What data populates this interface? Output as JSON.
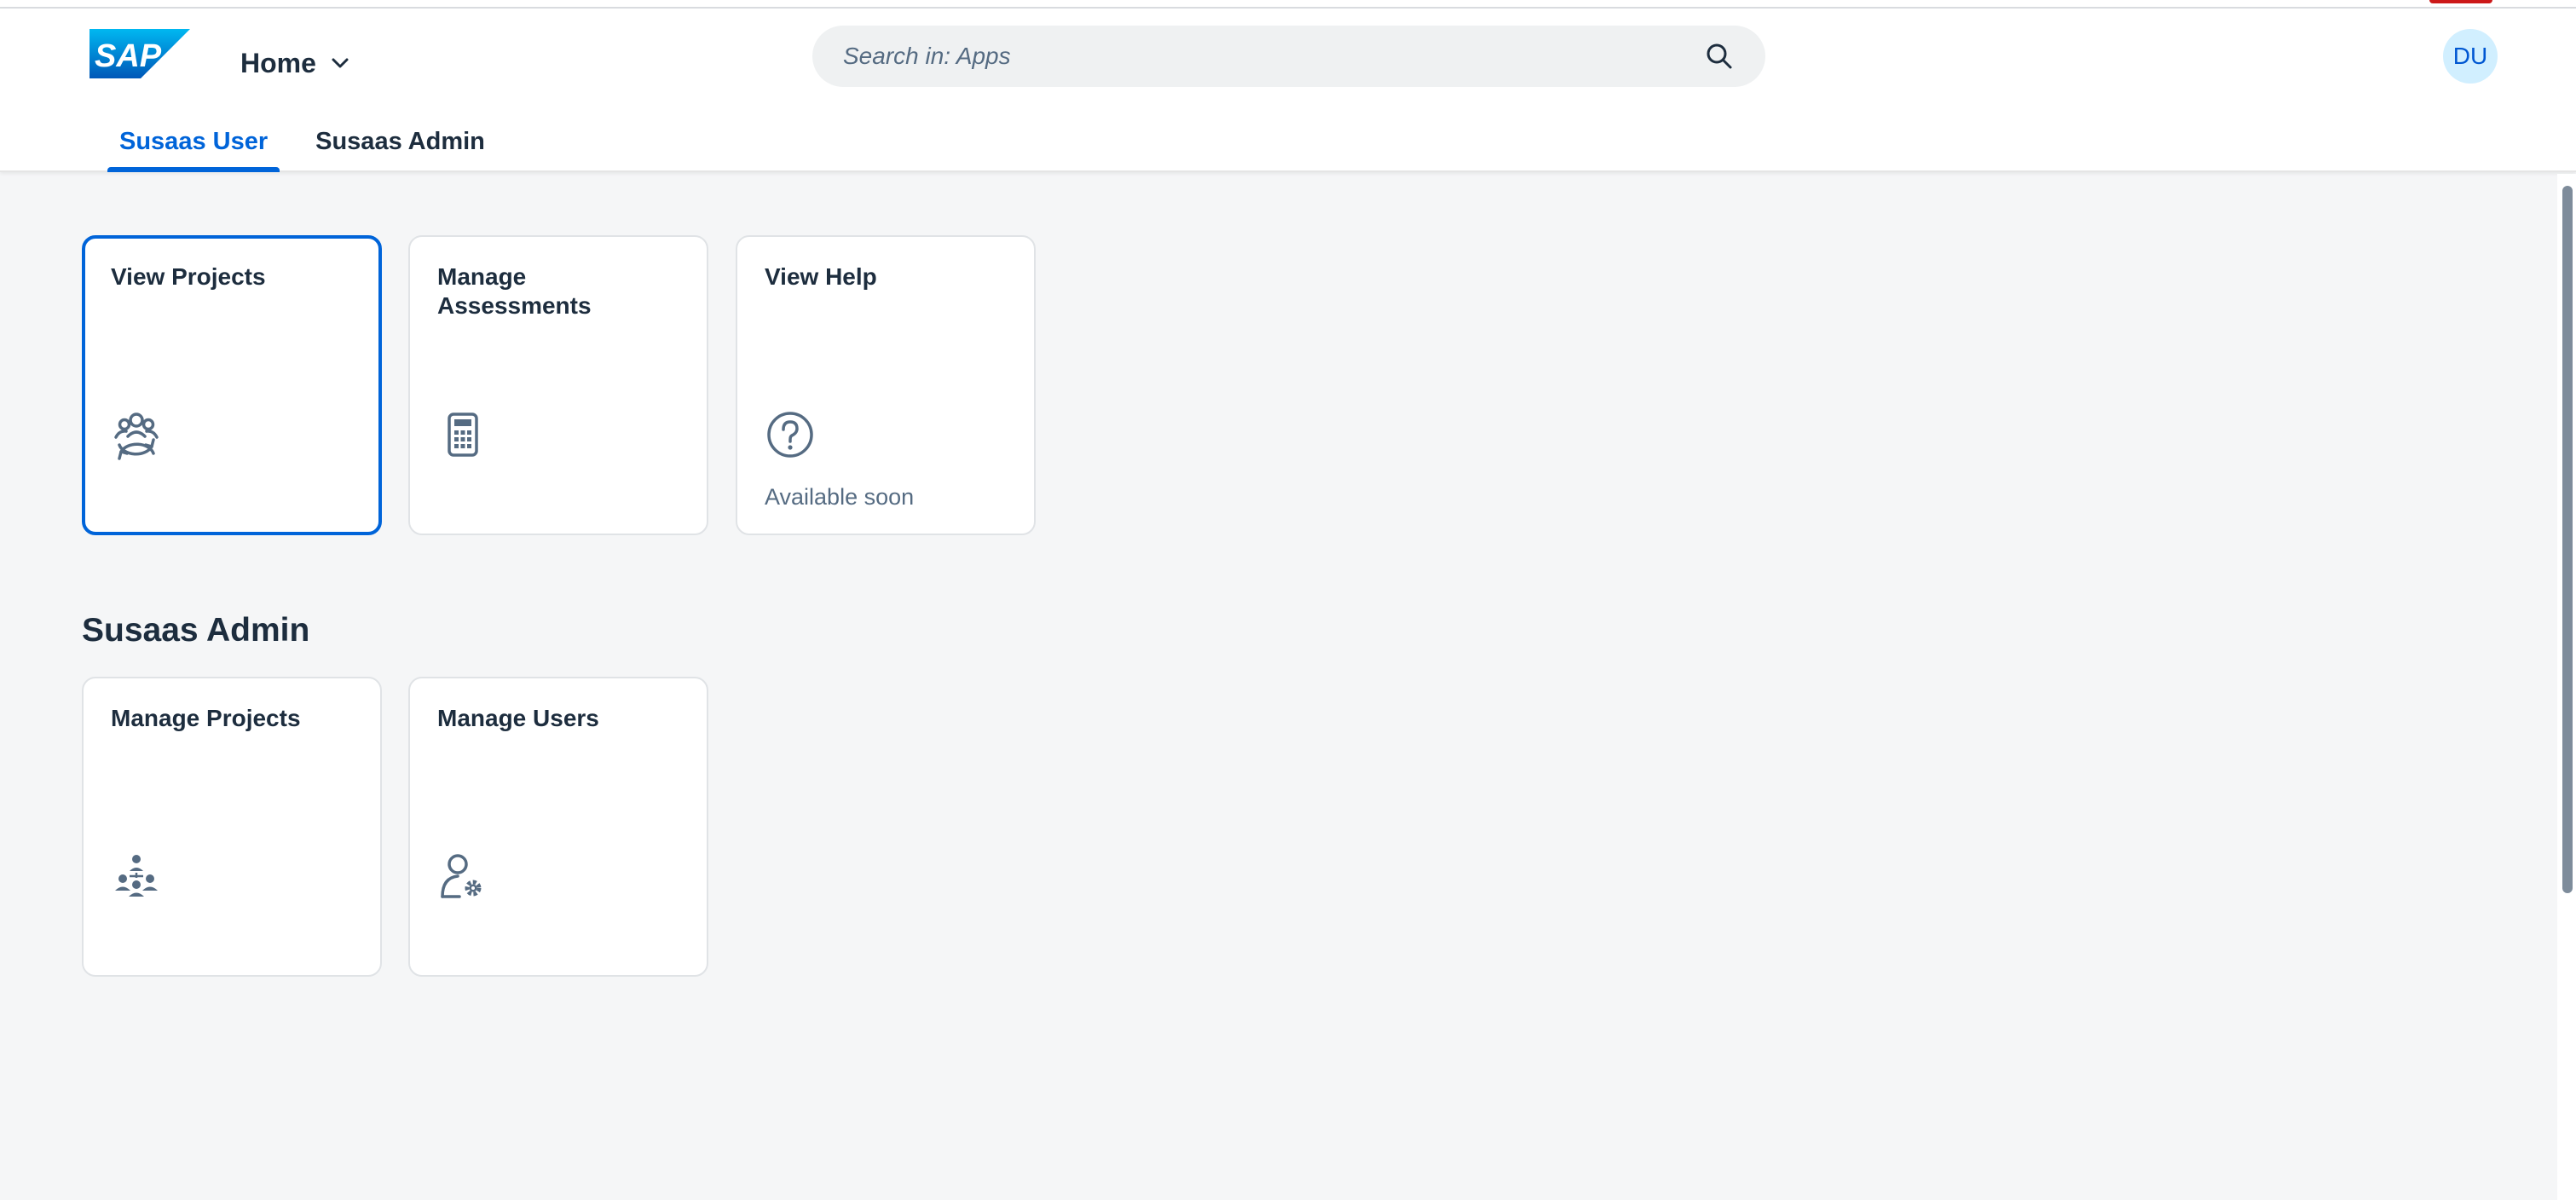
{
  "header": {
    "logo_text": "SAP",
    "home_label": "Home",
    "search_placeholder": "Search in: Apps",
    "avatar_initials": "DU"
  },
  "tabs": [
    {
      "label": "Susaas User",
      "active": true
    },
    {
      "label": "Susaas Admin",
      "active": false
    }
  ],
  "user_tiles": [
    {
      "title": "View Projects",
      "icon": "people-sync-icon",
      "footer": ""
    },
    {
      "title": "Manage Assessments",
      "icon": "calculator-icon",
      "footer": ""
    },
    {
      "title": "View Help",
      "icon": "question-circle-icon",
      "footer": "Available soon"
    }
  ],
  "admin_section": {
    "title": "Susaas Admin"
  },
  "admin_tiles": [
    {
      "title": "Manage Projects",
      "icon": "org-hierarchy-icon",
      "footer": ""
    },
    {
      "title": "Manage Users",
      "icon": "user-settings-icon",
      "footer": ""
    }
  ],
  "colors": {
    "brand_blue": "#0064d9",
    "text": "#1d2d3e",
    "icon": "#556b82",
    "background": "#f5f6f7"
  }
}
